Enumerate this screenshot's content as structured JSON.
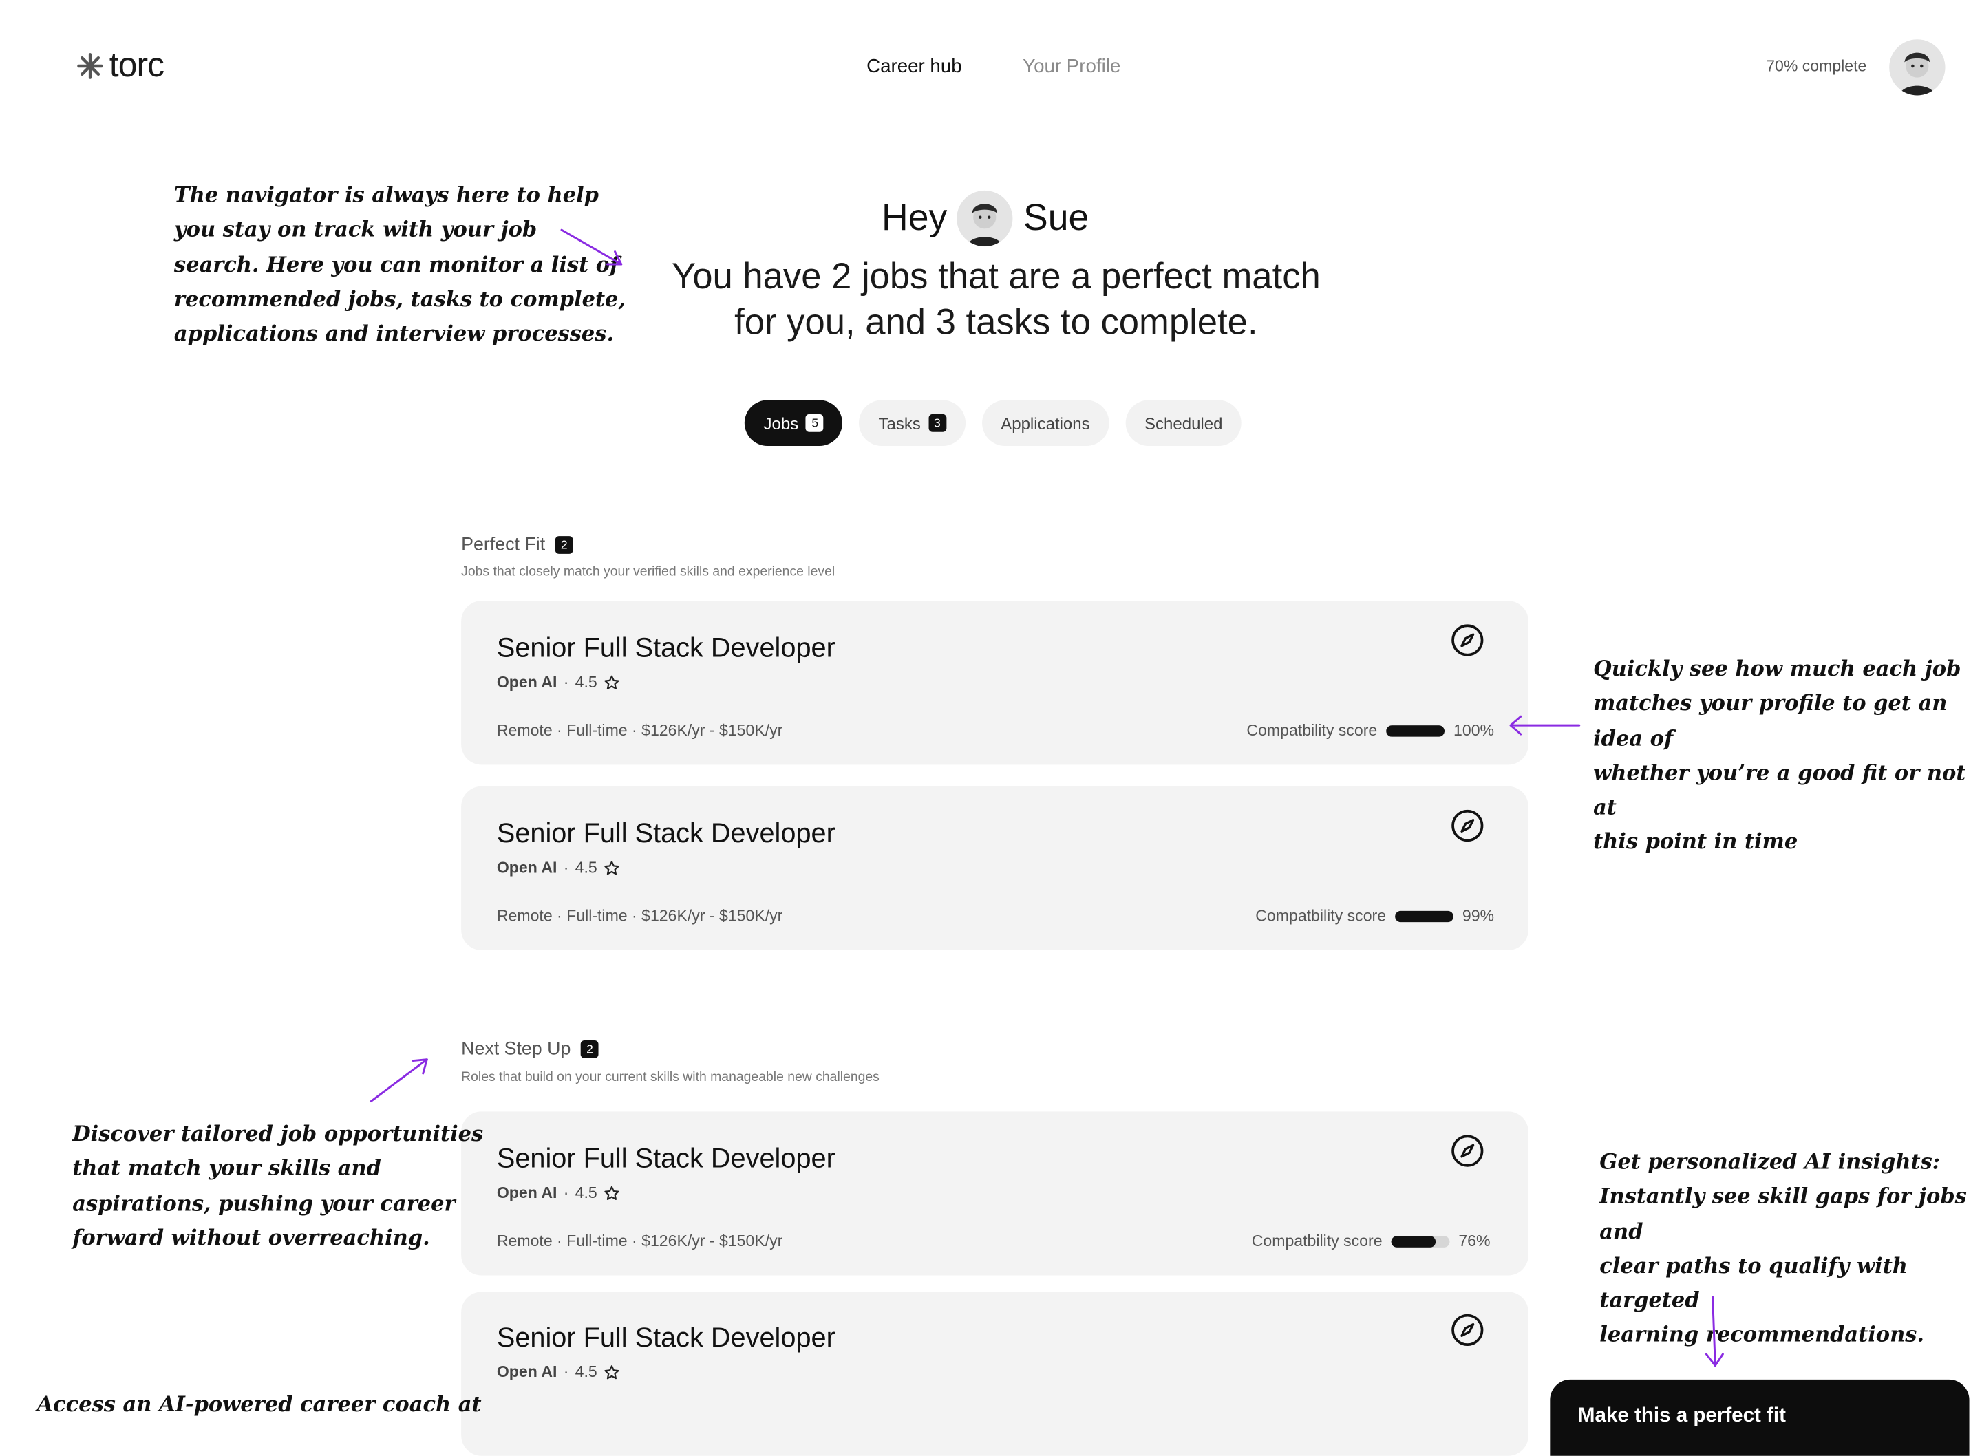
{
  "header": {
    "logo_text": "torc",
    "nav": [
      {
        "label": "Career hub",
        "active": true
      },
      {
        "label": "Your Profile",
        "active": false
      }
    ],
    "completion": "70% complete"
  },
  "hero": {
    "greeting_prefix": "Hey",
    "name": "Sue",
    "line1": "You have 2 jobs that are a perfect match",
    "line2": "for you, and 3 tasks to complete."
  },
  "tabs": [
    {
      "label": "Jobs",
      "count": "5",
      "active": true
    },
    {
      "label": "Tasks",
      "count": "3",
      "active": false
    },
    {
      "label": "Applications",
      "count": "",
      "active": false
    },
    {
      "label": "Scheduled",
      "count": "",
      "active": false
    }
  ],
  "sections": [
    {
      "title": "Perfect Fit",
      "count": "2",
      "subtitle": "Jobs that closely match your verified skills and experience level",
      "jobs": [
        {
          "title": "Senior Full Stack Developer",
          "company": "Open AI",
          "rating": "4.5",
          "details": "Remote · Full-time  · $126K/yr - $150K/yr",
          "score_label": "Compatbility score",
          "score": "100%",
          "score_value": 100
        },
        {
          "title": "Senior Full Stack Developer",
          "company": "Open AI",
          "rating": "4.5",
          "details": "Remote · Full-time  · $126K/yr - $150K/yr",
          "score_label": "Compatbility score",
          "score": "99%",
          "score_value": 99
        }
      ]
    },
    {
      "title": "Next Step Up",
      "count": "2",
      "subtitle": "Roles that build on your current skills with manageable new challenges",
      "jobs": [
        {
          "title": "Senior Full Stack Developer",
          "company": "Open AI",
          "rating": "4.5",
          "details": "Remote · Full-time  · $126K/yr - $150K/yr",
          "score_label": "Compatbility score",
          "score": "76%",
          "score_value": 76
        },
        {
          "title": "Senior Full Stack Developer",
          "company": "Open AI",
          "rating": "4.5",
          "details": "",
          "score_label": "",
          "score": "",
          "score_value": 0
        }
      ]
    }
  ],
  "annotations": {
    "navigator": [
      "The navigator is always here to help",
      "you stay on track with your job",
      "search. Here you can monitor a list of",
      "recommended jobs, tasks to complete,",
      "applications and interview processes."
    ],
    "compatibility": [
      "Quickly see how much each job",
      "matches your profile to get an idea of",
      "whether you’re a good fit or not at",
      "this point in time"
    ],
    "discover": [
      "Discover tailored job opportunities",
      "that match your skills and",
      "aspirations, pushing your career",
      "forward without overreaching."
    ],
    "insights": [
      "Get personalized AI insights:",
      "Instantly see skill gaps for jobs and",
      "clear paths to qualify with targeted",
      "learning recommendations."
    ],
    "coach": [
      "Access an AI-powered career coach at"
    ]
  },
  "promo": {
    "label": "Make this a perfect fit"
  },
  "colors": {
    "accent_arrow": "#8a2be2",
    "dark": "#111111",
    "card_bg": "#f3f3f3"
  }
}
